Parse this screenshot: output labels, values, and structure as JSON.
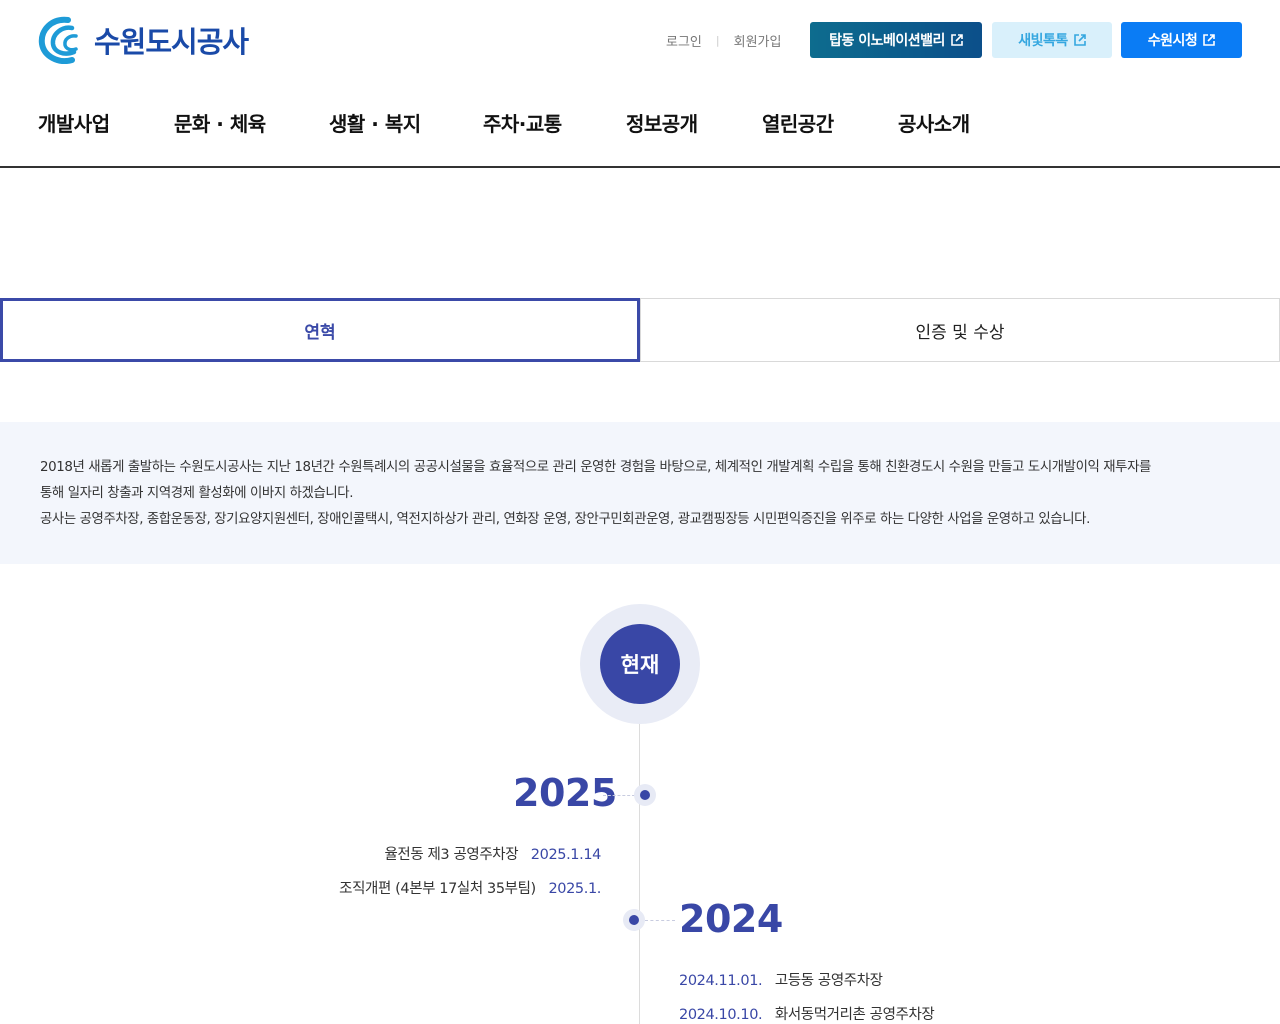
{
  "header": {
    "logo_text": "수원도시공사",
    "util": {
      "login": "로그인",
      "join": "회원가입"
    },
    "buttons": {
      "innovation": "탑동 이노베이션밸리",
      "talk": "새빛톡톡",
      "city": "수원시청"
    },
    "gnb": [
      "개발사업",
      "문화 · 체육",
      "생활 · 복지",
      "주차·교통",
      "정보공개",
      "열린공간",
      "공사소개"
    ]
  },
  "tabs": [
    {
      "label": "연혁",
      "active": true
    },
    {
      "label": "인증 및 수상",
      "active": false
    }
  ],
  "intro": {
    "line1": "2018년 새롭게 출발하는 수원도시공사는 지난 18년간 수원특례시의 공공시설물을 효율적으로 관리 운영한 경험을 바탕으로, 체계적인 개발계획 수립을 통해 친환경도시 수원을 만들고 도시개발이익 재투자를",
    "line2": "통해 일자리 창출과 지역경제 활성화에 이바지 하겠습니다.",
    "line3": "공사는 공영주차장, 종합운동장, 장기요양지원센터, 장애인콜택시, 역전지하상가 관리, 연화장 운영, 장안구민회관운영, 광교캠핑장등 시민편익증진을 위주로 하는 다양한 사업을 운영하고 있습니다."
  },
  "timeline": {
    "now_label": "현재",
    "y2025": {
      "year": "2025",
      "entries": [
        {
          "text": "율전동 제3 공영주차장",
          "date": "2025.1.14"
        },
        {
          "text": "조직개편 (4본부 17실처 35부팀)",
          "date": "2025.1."
        }
      ]
    },
    "y2024": {
      "year": "2024",
      "entries": [
        {
          "date": "2024.11.01.",
          "text": "고등동 공영주차장"
        },
        {
          "date": "2024.10.10.",
          "text": "화서동먹거리촌 공영주차장"
        }
      ]
    }
  },
  "colors": {
    "primary": "#3947a6",
    "intro_bg": "#f3f6fc",
    "city_btn": "#0a7cf5"
  }
}
